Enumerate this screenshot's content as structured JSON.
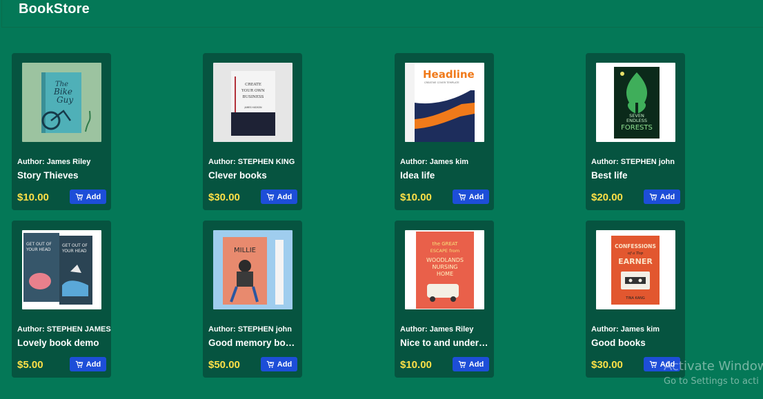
{
  "app": {
    "brand": "BookStore"
  },
  "books": [
    {
      "author": "Author: James Riley",
      "title": "Story Thieves",
      "price": "$10.00",
      "add_label": "Add",
      "cover": "bike-guy"
    },
    {
      "author": "Author: STEPHEN KING",
      "title": "Clever books",
      "price": "$30.00",
      "add_label": "Add",
      "cover": "create-business"
    },
    {
      "author": "Author: James kim",
      "title": "Idea life",
      "price": "$10.00",
      "add_label": "Add",
      "cover": "headline"
    },
    {
      "author": "Author: STEPHEN john",
      "title": "Best life",
      "price": "$20.00",
      "add_label": "Add",
      "cover": "seven-forests"
    },
    {
      "author": "Author: STEPHEN JAMES",
      "title": "Lovely book demo",
      "price": "$5.00",
      "add_label": "Add",
      "cover": "get-out-head"
    },
    {
      "author": "Author: STEPHEN john",
      "title": "Good memory books",
      "price": "$50.00",
      "add_label": "Add",
      "cover": "millie"
    },
    {
      "author": "Author: James Riley",
      "title": "Nice to and understand",
      "price": "$10.00",
      "add_label": "Add",
      "cover": "woodlands"
    },
    {
      "author": "Author: James kim",
      "title": "Good books",
      "price": "$30.00",
      "add_label": "Add",
      "cover": "confessions"
    }
  ],
  "covers": {
    "bike": {
      "line1": "The",
      "line2": "Bike",
      "line3": "Guy"
    },
    "business": {
      "line1": "CREATE",
      "line2": "YOUR OWN",
      "line3": "BUSINESS",
      "author": "JAMES HUDSON"
    },
    "headline": {
      "word": "Headline",
      "sub": "CREATIVE COVER TEMPLATE"
    },
    "forests": {
      "line1": "SEVEN",
      "line2": "ENDLESS",
      "line3": "FORESTS"
    },
    "head": {
      "line1": "GET OUT OF",
      "line2": "YOUR HEAD"
    },
    "millie": {
      "word": "MILLIE"
    },
    "woodlands": {
      "line1": "the GREAT",
      "line2": "ESCAPE from",
      "line3": "WOODLANDS",
      "line4": "NURSING",
      "line5": "HOME"
    },
    "confessions": {
      "line1": "CONFESSIONS",
      "line2": "of a Top",
      "line3": "EARNER",
      "author": "TINA KANG"
    }
  },
  "watermark": {
    "line1": "Activate Window",
    "line2": "Go to Settings to acti"
  },
  "colors": {
    "background": "#047857",
    "card": "#065440",
    "price": "#fde047",
    "button": "#1d4ed8"
  }
}
